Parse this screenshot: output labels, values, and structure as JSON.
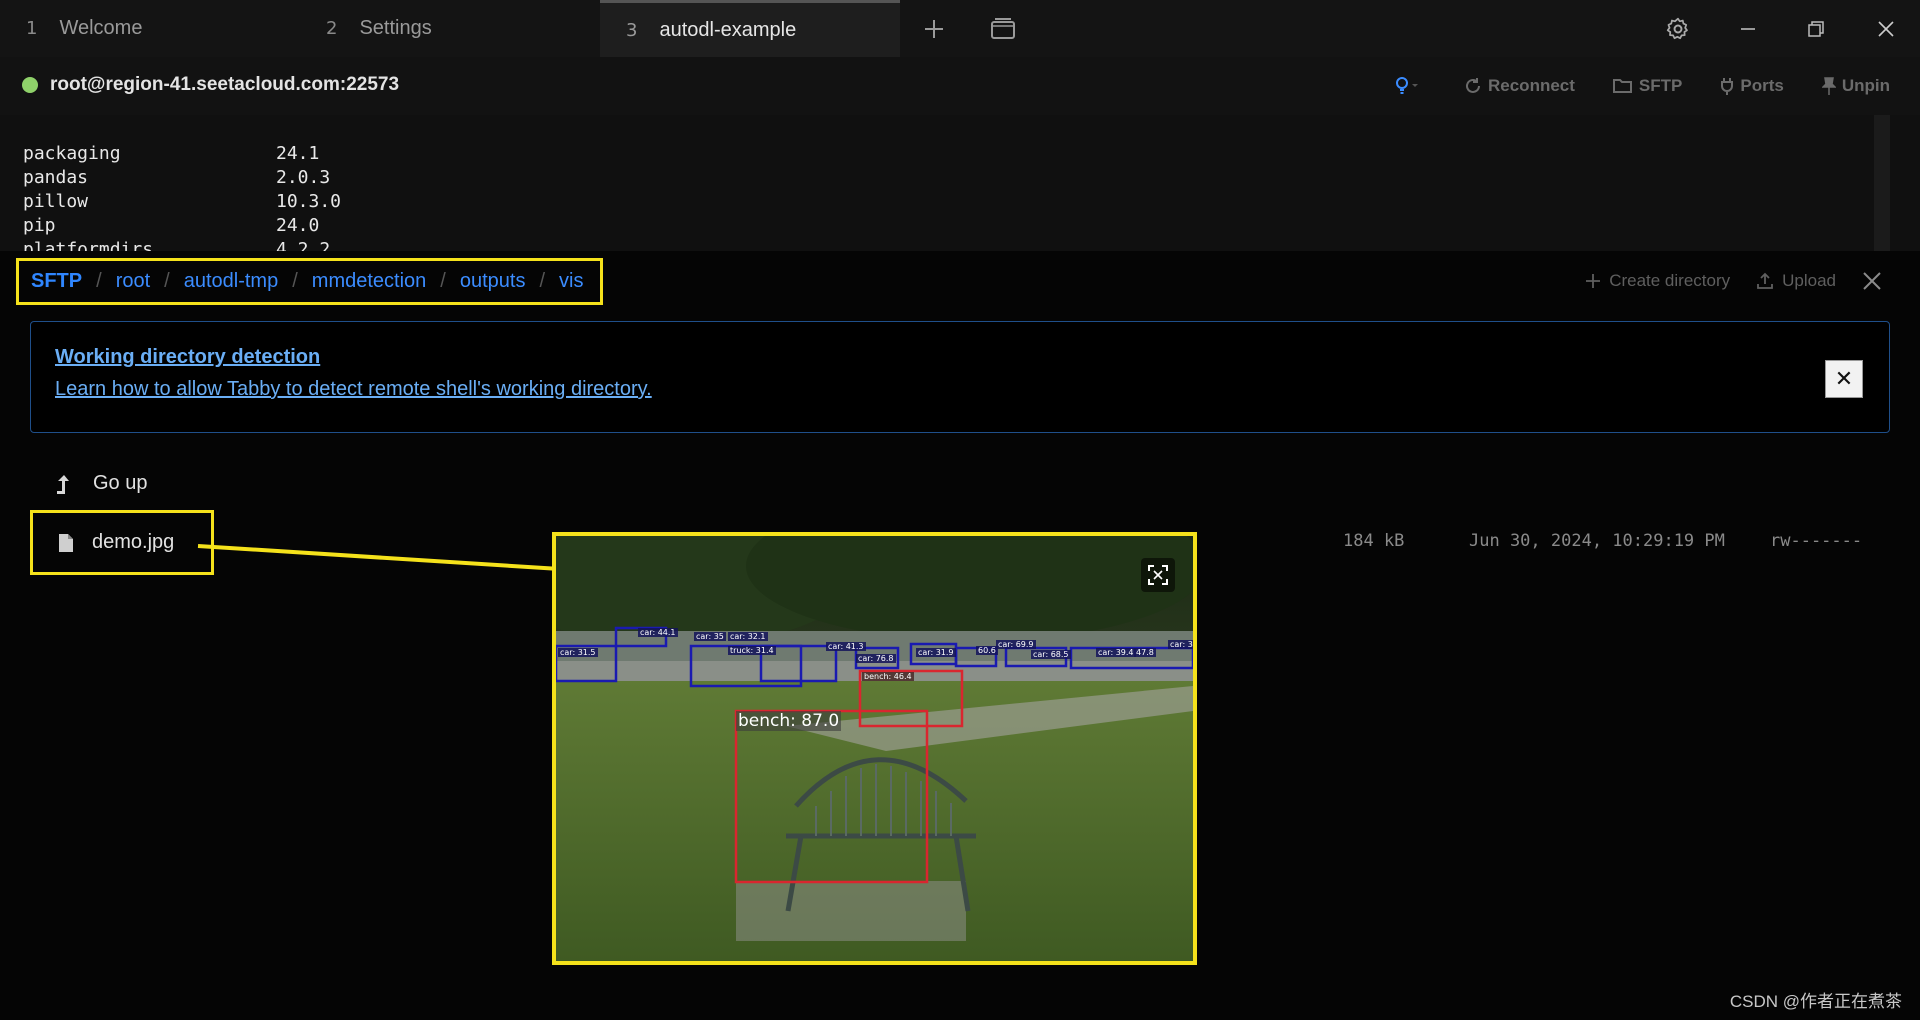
{
  "tabs": [
    {
      "num": "1",
      "label": "Welcome"
    },
    {
      "num": "2",
      "label": "Settings"
    },
    {
      "num": "3",
      "label": "autodl-example"
    }
  ],
  "connection": {
    "host": "root@region-41.seetacloud.com:22573",
    "status_color": "#8fd16a",
    "actions": {
      "reconnect": "Reconnect",
      "sftp": "SFTP",
      "ports": "Ports",
      "unpin": "Unpin"
    }
  },
  "terminal": {
    "lines": [
      {
        "name": "packaging",
        "version": "24.1"
      },
      {
        "name": "pandas",
        "version": "2.0.3"
      },
      {
        "name": "pillow",
        "version": "10.3.0"
      },
      {
        "name": "pip",
        "version": "24.0"
      },
      {
        "name": "platformdirs",
        "version": "4.2.2"
      }
    ]
  },
  "sftp": {
    "breadcrumb": [
      "SFTP",
      "root",
      "autodl-tmp",
      "mmdetection",
      "outputs",
      "vis"
    ],
    "create_directory": "Create directory",
    "upload": "Upload",
    "notice_title": "Working directory detection",
    "notice_text": "Learn how to allow Tabby to detect remote shell's working directory.",
    "go_up": "Go up",
    "file": {
      "name": "demo.jpg",
      "size": "184 kB",
      "date": "Jun 30, 2024, 10:29:19 PM",
      "perms": "rw-------"
    },
    "preview_labels": {
      "bench_main": "bench: 87.0",
      "bench_small": "bench: 46.4",
      "cars": [
        "car: 31.5",
        "car: 44.1",
        "car: 35",
        "car: 32.1",
        "truck: 31.4",
        "car: 41.3",
        "car: 76.8",
        "car: 31.9",
        "60.6",
        "car: 69.9",
        "car: 68.5",
        "car: 39.4",
        "47.8",
        "car: 3"
      ]
    }
  },
  "watermark": "CSDN @作者正在煮茶",
  "colors": {
    "highlight": "#f5e21b",
    "link": "#3b8cff",
    "bench_box": "#d9262f",
    "car_box": "#1a1ab0"
  }
}
